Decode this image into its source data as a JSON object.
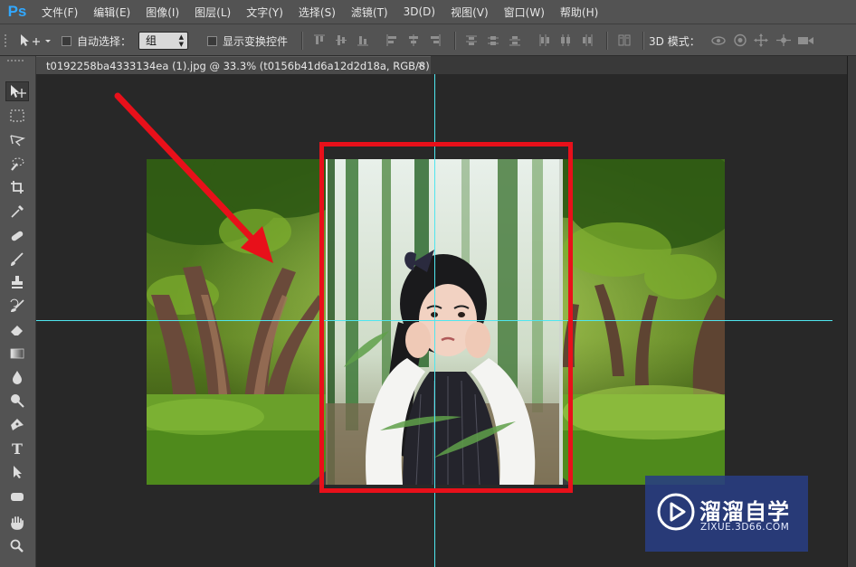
{
  "app": {
    "logo_text": "Ps",
    "accent": "#31a8ff"
  },
  "menu": {
    "items": [
      "文件(F)",
      "编辑(E)",
      "图像(I)",
      "图层(L)",
      "文字(Y)",
      "选择(S)",
      "滤镜(T)",
      "3D(D)",
      "视图(V)",
      "窗口(W)",
      "帮助(H)"
    ]
  },
  "options": {
    "auto_select_label": "自动选择：",
    "auto_select_checked": false,
    "group_value": "组",
    "show_transform_label": "显示变换控件",
    "show_transform_checked": false,
    "mode_3d_label": "3D 模式："
  },
  "document": {
    "tab_title": "t0192258ba4333134ea (1).jpg @ 33.3% (t0156b41d6a12d2d18a, RGB/8) *",
    "close_glyph": "×"
  },
  "annotation": {
    "color": "#e8101a"
  },
  "guides": {
    "color": "#4fe6ef"
  },
  "watermark": {
    "title": "溜溜自学",
    "url": "ZIXUE.3D66.COM"
  },
  "tools": [
    "move-tool",
    "marquee-tool",
    "lasso-tool",
    "quick-selection-tool",
    "crop-tool",
    "eyedropper-tool",
    "healing-brush-tool",
    "brush-tool",
    "clone-stamp-tool",
    "history-brush-tool",
    "eraser-tool",
    "gradient-tool",
    "blur-tool",
    "dodge-tool",
    "pen-tool",
    "type-tool",
    "path-selection-tool",
    "shape-tool",
    "hand-tool",
    "zoom-tool"
  ],
  "tool_type_glyph": "T"
}
